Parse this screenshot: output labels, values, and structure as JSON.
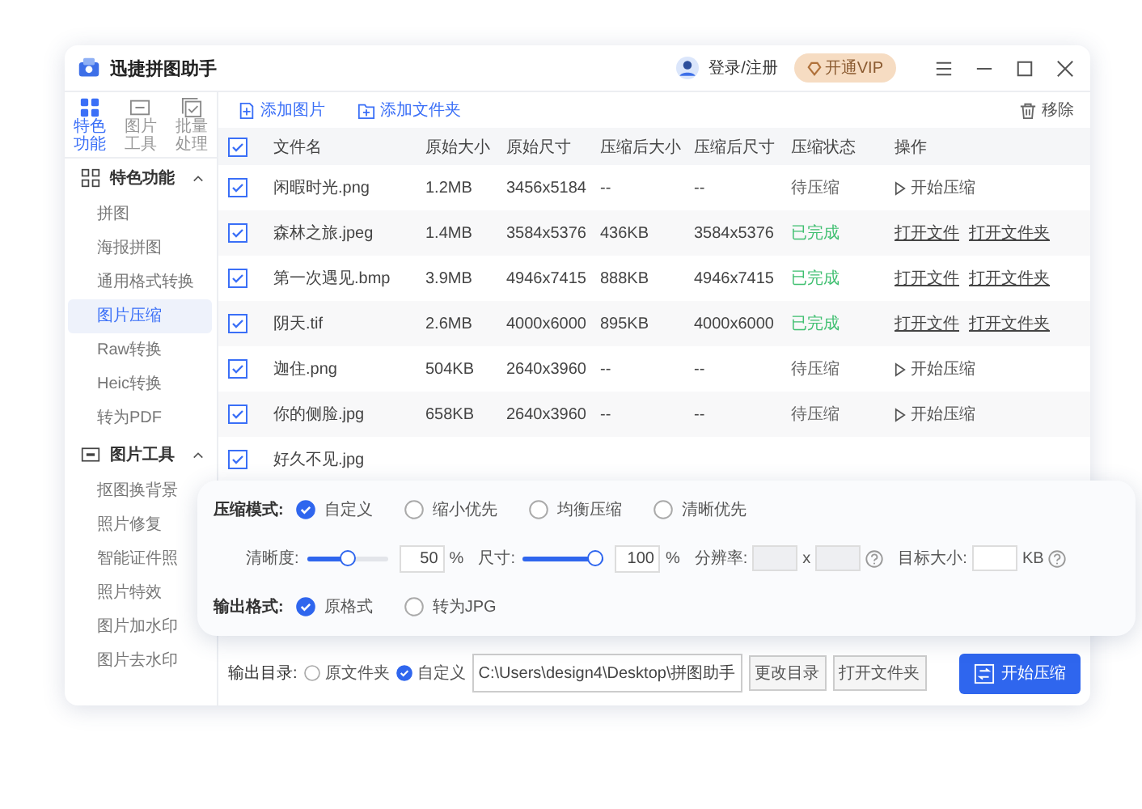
{
  "window": {
    "title": "迅捷拼图助手"
  },
  "account": {
    "login": "登录/注册",
    "vip": "开通VIP"
  },
  "sidebar": {
    "tabs": [
      {
        "label": "特色功能",
        "selected": true
      },
      {
        "label": "图片工具",
        "selected": false
      },
      {
        "label": "批量处理",
        "selected": false
      }
    ],
    "groups": [
      {
        "label": "特色功能",
        "expanded": true,
        "items": [
          {
            "label": "拼图",
            "selected": false
          },
          {
            "label": "海报拼图",
            "selected": false
          },
          {
            "label": "通用格式转换",
            "selected": false
          },
          {
            "label": "图片压缩",
            "selected": true
          },
          {
            "label": "Raw转换",
            "selected": false
          },
          {
            "label": "Heic转换",
            "selected": false
          },
          {
            "label": "转为PDF",
            "selected": false
          }
        ]
      },
      {
        "label": "图片工具",
        "expanded": true,
        "items": [
          {
            "label": "抠图换背景",
            "selected": false
          },
          {
            "label": "照片修复",
            "selected": false
          },
          {
            "label": "智能证件照",
            "selected": false
          },
          {
            "label": "照片特效",
            "selected": false
          },
          {
            "label": "图片加水印",
            "selected": false
          },
          {
            "label": "图片去水印",
            "selected": false
          }
        ]
      }
    ]
  },
  "toolbar": {
    "add_image": "添加图片",
    "add_folder": "添加文件夹",
    "remove": "移除"
  },
  "table": {
    "header_checked": true,
    "columns": [
      "文件名",
      "原始大小",
      "原始尺寸",
      "压缩后大小",
      "压缩后尺寸",
      "压缩状态",
      "操作"
    ],
    "rows": [
      {
        "checked": true,
        "name": "闲暇时光.png",
        "original_size": "1.2MB",
        "original_dims": "3456x5184",
        "compressed_size": "--",
        "compressed_dims": "--",
        "status": "待压缩",
        "kind": "pending",
        "actions": [
          "开始压缩"
        ]
      },
      {
        "checked": true,
        "name": "森林之旅.jpeg",
        "original_size": "1.4MB",
        "original_dims": "3584x5376",
        "compressed_size": "436KB",
        "compressed_dims": "3584x5376",
        "status": "已完成",
        "kind": "done",
        "actions": [
          "打开文件",
          "打开文件夹"
        ]
      },
      {
        "checked": true,
        "name": "第一次遇见.bmp",
        "original_size": "3.9MB",
        "original_dims": "4946x7415",
        "compressed_size": "888KB",
        "compressed_dims": "4946x7415",
        "status": "已完成",
        "kind": "done",
        "actions": [
          "打开文件",
          "打开文件夹"
        ]
      },
      {
        "checked": true,
        "name": "阴天.tif",
        "original_size": "2.6MB",
        "original_dims": "4000x6000",
        "compressed_size": "895KB",
        "compressed_dims": "4000x6000",
        "status": "已完成",
        "kind": "done",
        "actions": [
          "打开文件",
          "打开文件夹"
        ]
      },
      {
        "checked": true,
        "name": "迦住.png",
        "original_size": "504KB",
        "original_dims": "2640x3960",
        "compressed_size": "--",
        "compressed_dims": "--",
        "status": "待压缩",
        "kind": "pending",
        "actions": [
          "开始压缩"
        ]
      },
      {
        "checked": true,
        "name": "你的侧脸.jpg",
        "original_size": "658KB",
        "original_dims": "2640x3960",
        "compressed_size": "--",
        "compressed_dims": "--",
        "status": "待压缩",
        "kind": "pending",
        "actions": [
          "开始压缩"
        ]
      },
      {
        "checked": true,
        "name": "好久不见.jpg"
      }
    ]
  },
  "compression": {
    "mode_label": "压缩模式:",
    "modes": [
      {
        "label": "自定义",
        "selected": true
      },
      {
        "label": "缩小优先",
        "selected": false
      },
      {
        "label": "均衡压缩",
        "selected": false
      },
      {
        "label": "清晰优先",
        "selected": false
      }
    ],
    "clarity": {
      "label": "清晰度:",
      "level": 0.5,
      "value": "50",
      "unit": "%"
    },
    "size": {
      "label": "尺寸:",
      "level": 1,
      "value": "100",
      "unit": "%"
    },
    "resolution": {
      "label": "分辨率:",
      "separator": "x",
      "disabled": true
    },
    "target_size": {
      "label": "目标大小:",
      "unit": "KB"
    },
    "format_label": "输出格式:",
    "formats": [
      {
        "label": "原格式",
        "selected": true
      },
      {
        "label": "转为JPG",
        "selected": false
      }
    ]
  },
  "output": {
    "label": "输出目录:",
    "options": [
      {
        "label": "原文件夹",
        "selected": false
      },
      {
        "label": "自定义",
        "selected": true
      }
    ],
    "path": "C:\\Users\\design4\\Desktop\\拼图助手",
    "change_button": "更改目录",
    "open_button": "打开文件夹"
  },
  "start_button": "开始压缩"
}
